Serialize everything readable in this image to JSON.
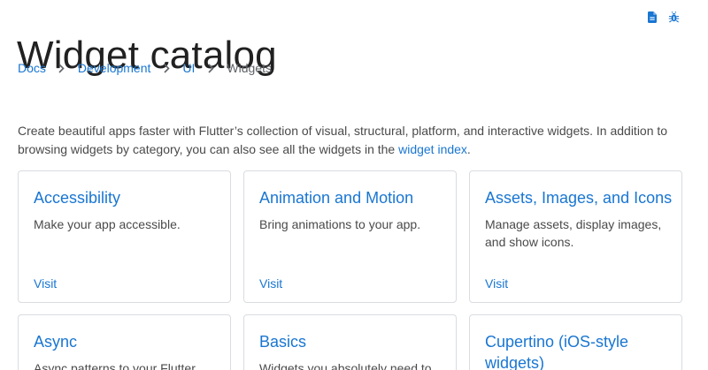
{
  "page": {
    "title": "Widget catalog"
  },
  "actions": {
    "view_source_icon": "document-icon",
    "report_bug_icon": "bug-icon",
    "accent": "#1976d2"
  },
  "breadcrumb": [
    {
      "label": "Docs"
    },
    {
      "label": "Development"
    },
    {
      "label": "UI"
    },
    {
      "label": "Widgets"
    }
  ],
  "intro": {
    "text": "Create beautiful apps faster with Flutter’s collection of visual, structural, platform, and interactive widgets. In addition to browsing widgets by category, you can also see all the widgets in the ",
    "link": "widget index",
    "suffix": "."
  },
  "cards": [
    {
      "title": "Accessibility",
      "desc": "Make your app accessible.",
      "visit": "Visit"
    },
    {
      "title": "Animation and Motion",
      "desc": "Bring animations to your app.",
      "visit": "Visit"
    },
    {
      "title": "Assets, Images, and Icons",
      "desc": "Manage assets, display images, and show icons.",
      "visit": "Visit"
    },
    {
      "title": "Async",
      "desc": "Async patterns to your Flutter",
      "visit": ""
    },
    {
      "title": "Basics",
      "desc": "Widgets you absolutely need to",
      "visit": ""
    },
    {
      "title": "Cupertino (iOS-style widgets)",
      "desc": "",
      "visit": ""
    }
  ]
}
